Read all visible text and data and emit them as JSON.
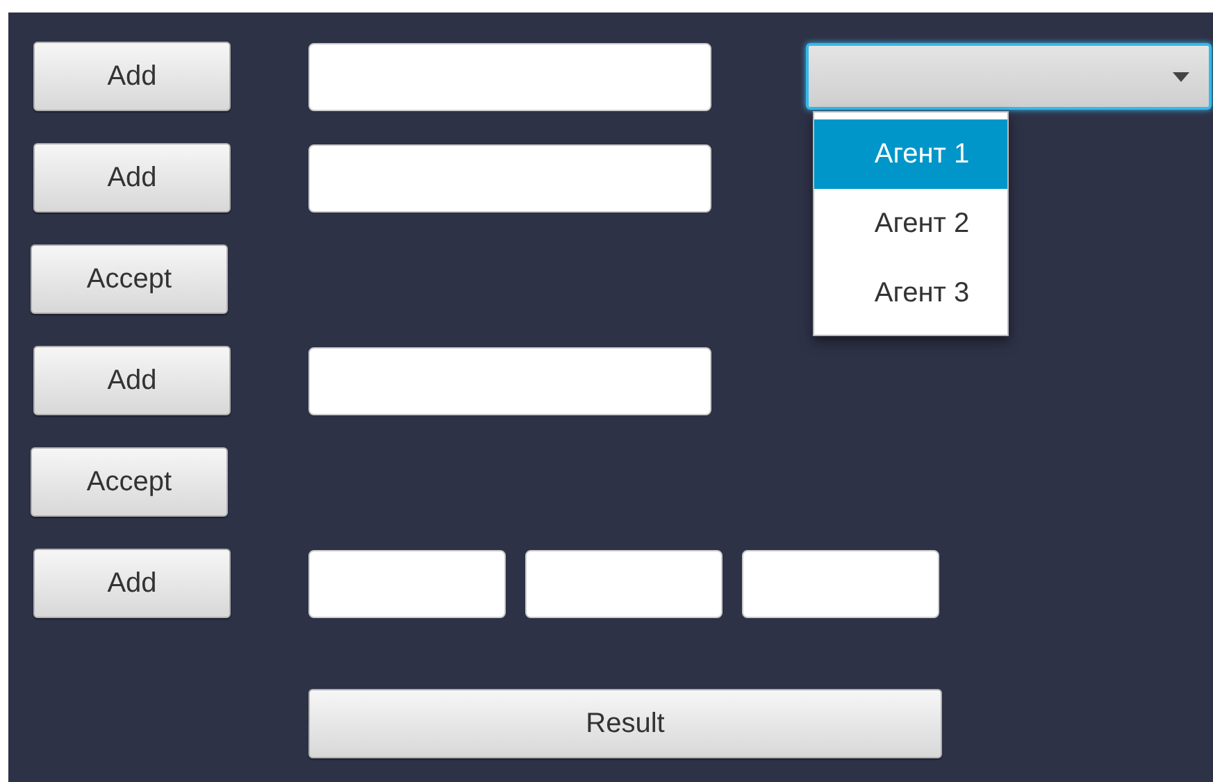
{
  "rows": [
    {
      "kind": "single",
      "button": "Add"
    },
    {
      "kind": "single",
      "button": "Add"
    },
    {
      "kind": "accept",
      "button": "Accept"
    },
    {
      "kind": "single",
      "button": "Add"
    },
    {
      "kind": "accept",
      "button": "Accept"
    },
    {
      "kind": "triple",
      "button": "Add"
    }
  ],
  "combo": {
    "expanded": true,
    "options": [
      {
        "label": "Агент 1",
        "selected": true
      },
      {
        "label": "Агент 2",
        "selected": false
      },
      {
        "label": "Агент 3",
        "selected": false
      }
    ]
  },
  "result_button": "Result"
}
